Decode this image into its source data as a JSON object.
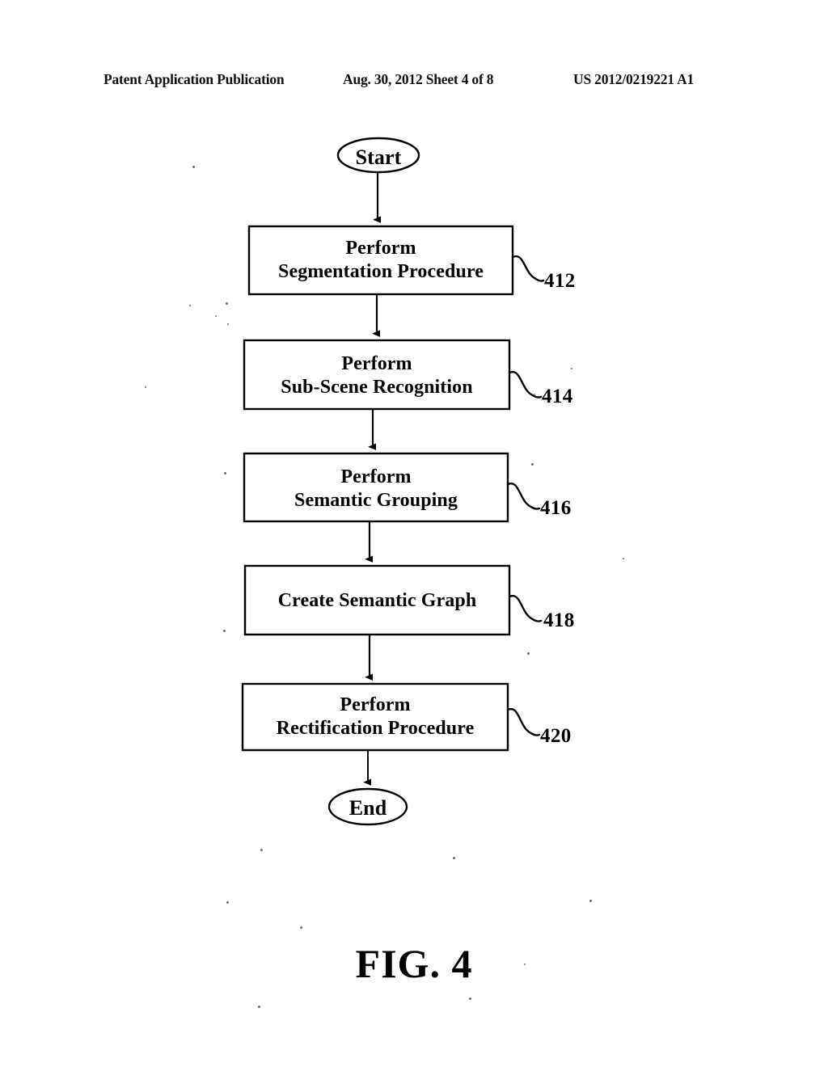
{
  "header": {
    "publication": "Patent Application Publication",
    "date_sheet": "Aug. 30, 2012  Sheet 4 of 8",
    "document_number": "US 2012/0219221 A1"
  },
  "figure": {
    "caption": "FIG. 4"
  },
  "chart_data": {
    "type": "diagram",
    "diagram_type": "flowchart",
    "orientation": "top-to-bottom",
    "title": "FIG. 4",
    "nodes": [
      {
        "id": "start",
        "shape": "ellipse",
        "label": "Start",
        "ref": ""
      },
      {
        "id": "n412",
        "shape": "rectangle",
        "label_lines": [
          "Perform",
          "Segmentation Procedure"
        ],
        "ref": "412"
      },
      {
        "id": "n414",
        "shape": "rectangle",
        "label_lines": [
          "Perform",
          "Sub-Scene Recognition"
        ],
        "ref": "414"
      },
      {
        "id": "n416",
        "shape": "rectangle",
        "label_lines": [
          "Perform",
          "Semantic Grouping"
        ],
        "ref": "416"
      },
      {
        "id": "n418",
        "shape": "rectangle",
        "label_lines": [
          "Create Semantic Graph"
        ],
        "ref": "418"
      },
      {
        "id": "n420",
        "shape": "rectangle",
        "label_lines": [
          "Perform",
          "Rectification Procedure"
        ],
        "ref": "420"
      },
      {
        "id": "end",
        "shape": "ellipse",
        "label": "End",
        "ref": ""
      }
    ],
    "edges": [
      {
        "from": "start",
        "to": "n412",
        "style": "arrow"
      },
      {
        "from": "n412",
        "to": "n414",
        "style": "arrow"
      },
      {
        "from": "n414",
        "to": "n416",
        "style": "arrow"
      },
      {
        "from": "n416",
        "to": "n418",
        "style": "arrow"
      },
      {
        "from": "n418",
        "to": "n420",
        "style": "arrow"
      },
      {
        "from": "n420",
        "to": "end",
        "style": "arrow"
      }
    ],
    "reference_numerals": [
      "412",
      "414",
      "416",
      "418",
      "420"
    ],
    "colors": {
      "stroke": "#000000",
      "fill": "#ffffff",
      "text": "#000000"
    }
  },
  "nodes": {
    "start": {
      "label": "Start"
    },
    "step_412": {
      "line1": "Perform",
      "line2": "Segmentation Procedure",
      "ref": "412"
    },
    "step_414": {
      "line1": "Perform",
      "line2": "Sub-Scene Recognition",
      "ref": "414"
    },
    "step_416": {
      "line1": "Perform",
      "line2": "Semantic Grouping",
      "ref": "416"
    },
    "step_418": {
      "line1": "Create Semantic Graph",
      "ref": "418"
    },
    "step_420": {
      "line1": "Perform",
      "line2": "Rectification Procedure",
      "ref": "420"
    },
    "end": {
      "label": "End"
    }
  }
}
